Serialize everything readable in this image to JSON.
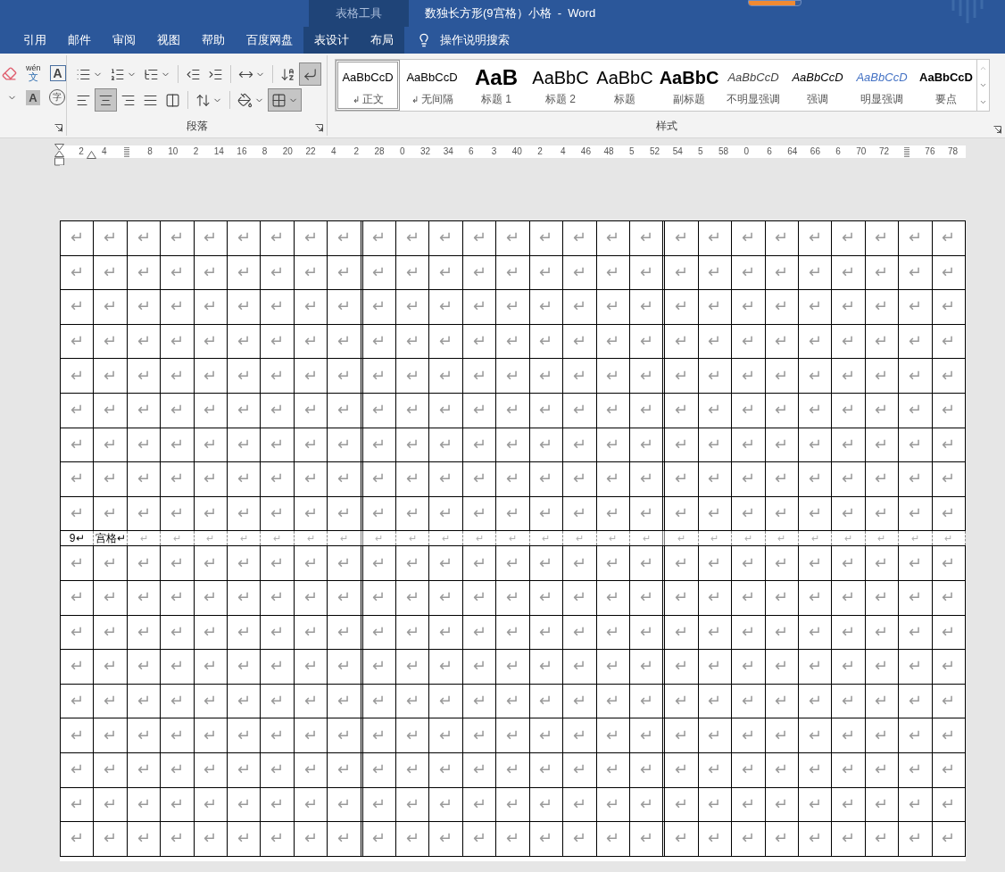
{
  "title_bar": {
    "context_label": "表格工具",
    "title": "数独长方形(9宫格）小格  -  Word",
    "progress": {
      "level": 0.9
    }
  },
  "tabs": [
    {
      "label": "引用",
      "contextual": false
    },
    {
      "label": "邮件",
      "contextual": false
    },
    {
      "label": "审阅",
      "contextual": false
    },
    {
      "label": "视图",
      "contextual": false
    },
    {
      "label": "帮助",
      "contextual": false
    },
    {
      "label": "百度网盘",
      "contextual": false
    },
    {
      "label": "表设计",
      "contextual": true
    },
    {
      "label": "布局",
      "contextual": true
    }
  ],
  "tell_me": {
    "label": "操作说明搜索"
  },
  "font_group": {
    "phonetic_top": "wén",
    "phonetic_char": "文",
    "border_char": "A",
    "shading_char": "A",
    "enclose_char": "字"
  },
  "paragraph_group": {
    "label": "段落",
    "rows": [
      [
        {
          "kind": "bullets",
          "dropdown": true,
          "pressed": false
        },
        {
          "kind": "numbering",
          "dropdown": true,
          "pressed": false
        },
        {
          "kind": "multilevel",
          "dropdown": true,
          "pressed": false
        },
        {
          "kind": "sep"
        },
        {
          "kind": "outdent",
          "dropdown": false,
          "pressed": false
        },
        {
          "kind": "indent",
          "dropdown": false,
          "pressed": false
        },
        {
          "kind": "sep"
        },
        {
          "kind": "layout",
          "dropdown": true,
          "pressed": false
        },
        {
          "kind": "sep"
        },
        {
          "kind": "sort",
          "dropdown": false,
          "pressed": false
        },
        {
          "kind": "marks",
          "dropdown": false,
          "pressed": true
        }
      ],
      [
        {
          "kind": "left",
          "dropdown": false,
          "pressed": false
        },
        {
          "kind": "center",
          "dropdown": false,
          "pressed": true
        },
        {
          "kind": "right",
          "dropdown": false,
          "pressed": false
        },
        {
          "kind": "justify",
          "dropdown": false,
          "pressed": false
        },
        {
          "kind": "distribute",
          "dropdown": false,
          "pressed": false
        },
        {
          "kind": "sep"
        },
        {
          "kind": "spacing",
          "dropdown": true,
          "pressed": false
        },
        {
          "kind": "sep"
        },
        {
          "kind": "shading",
          "dropdown": true,
          "pressed": false
        },
        {
          "kind": "borders",
          "dropdown": true,
          "pressed": true
        }
      ]
    ]
  },
  "styles_group": {
    "label": "样式",
    "items": [
      {
        "kind": "normal",
        "preview": "AaBbCcD",
        "mark": "↲",
        "name": "正文",
        "selected": true
      },
      {
        "kind": "normal",
        "preview": "AaBbCcD",
        "mark": "↲",
        "name": "无间隔",
        "selected": false
      },
      {
        "kind": "heading1",
        "preview": "AaB",
        "name": "标题 1",
        "selected": false
      },
      {
        "kind": "heading2",
        "preview": "AaBbC",
        "name": "标题 2",
        "selected": false
      },
      {
        "kind": "title",
        "preview": "AaBbC",
        "name": "标题",
        "selected": false
      },
      {
        "kind": "subtitle",
        "preview": "AaBbC",
        "name": "副标题",
        "selected": false
      },
      {
        "kind": "subtle",
        "preview": "AaBbCcD",
        "name": "不明显强调",
        "selected": false
      },
      {
        "kind": "emphasis",
        "preview": "AaBbCcD",
        "name": "强调",
        "selected": false
      },
      {
        "kind": "intense",
        "preview": "AaBbCcD",
        "name": "明显强调",
        "selected": false
      },
      {
        "kind": "strong",
        "preview": "AaBbCcD",
        "name": "要点",
        "selected": false
      }
    ]
  },
  "ruler": {
    "ticks": [
      {
        "label": "2"
      },
      {
        "label": "4"
      },
      {
        "kind": "covered"
      },
      {
        "label": "8"
      },
      {
        "label": "10"
      },
      {
        "label": "2"
      },
      {
        "label": "14"
      },
      {
        "label": "16"
      },
      {
        "label": "8"
      },
      {
        "label": "20"
      },
      {
        "label": "22"
      },
      {
        "label": "4"
      },
      {
        "label": "2"
      },
      {
        "label": "28"
      },
      {
        "label": "0"
      },
      {
        "label": "32"
      },
      {
        "label": "34"
      },
      {
        "label": "6"
      },
      {
        "label": "3"
      },
      {
        "label": "40"
      },
      {
        "label": "2"
      },
      {
        "label": "4"
      },
      {
        "label": "46"
      },
      {
        "label": "48"
      },
      {
        "label": "5"
      },
      {
        "label": "52"
      },
      {
        "label": "54"
      },
      {
        "label": "5"
      },
      {
        "label": "58"
      },
      {
        "label": "0"
      },
      {
        "label": "6"
      },
      {
        "label": "64"
      },
      {
        "label": "66"
      },
      {
        "label": "6"
      },
      {
        "label": "70"
      },
      {
        "label": "72"
      },
      {
        "kind": "covered"
      },
      {
        "label": "76"
      },
      {
        "label": "78"
      }
    ]
  },
  "table": {
    "rows": [
      {
        "kind": "grid",
        "cells": [
          "↵",
          "↵",
          "↵",
          "↵",
          "↵",
          "↵",
          "↵",
          "↵",
          "↵",
          "↵",
          "↵",
          "↵",
          "↵",
          "↵",
          "↵",
          "↵",
          "↵",
          "↵",
          "↵",
          "↵",
          "↵",
          "↵",
          "↵",
          "↵",
          "↵",
          "↵",
          "↵"
        ]
      },
      {
        "kind": "grid",
        "cells": [
          "↵",
          "↵",
          "↵",
          "↵",
          "↵",
          "↵",
          "↵",
          "↵",
          "↵",
          "↵",
          "↵",
          "↵",
          "↵",
          "↵",
          "↵",
          "↵",
          "↵",
          "↵",
          "↵",
          "↵",
          "↵",
          "↵",
          "↵",
          "↵",
          "↵",
          "↵",
          "↵"
        ]
      },
      {
        "kind": "grid",
        "cells": [
          "↵",
          "↵",
          "↵",
          "↵",
          "↵",
          "↵",
          "↵",
          "↵",
          "↵",
          "↵",
          "↵",
          "↵",
          "↵",
          "↵",
          "↵",
          "↵",
          "↵",
          "↵",
          "↵",
          "↵",
          "↵",
          "↵",
          "↵",
          "↵",
          "↵",
          "↵",
          "↵"
        ]
      },
      {
        "kind": "grid",
        "cells": [
          "↵",
          "↵",
          "↵",
          "↵",
          "↵",
          "↵",
          "↵",
          "↵",
          "↵",
          "↵",
          "↵",
          "↵",
          "↵",
          "↵",
          "↵",
          "↵",
          "↵",
          "↵",
          "↵",
          "↵",
          "↵",
          "↵",
          "↵",
          "↵",
          "↵",
          "↵",
          "↵"
        ]
      },
      {
        "kind": "grid",
        "cells": [
          "↵",
          "↵",
          "↵",
          "↵",
          "↵",
          "↵",
          "↵",
          "↵",
          "↵",
          "↵",
          "↵",
          "↵",
          "↵",
          "↵",
          "↵",
          "↵",
          "↵",
          "↵",
          "↵",
          "↵",
          "↵",
          "↵",
          "↵",
          "↵",
          "↵",
          "↵",
          "↵"
        ]
      },
      {
        "kind": "grid",
        "cells": [
          "↵",
          "↵",
          "↵",
          "↵",
          "↵",
          "↵",
          "↵",
          "↵",
          "↵",
          "↵",
          "↵",
          "↵",
          "↵",
          "↵",
          "↵",
          "↵",
          "↵",
          "↵",
          "↵",
          "↵",
          "↵",
          "↵",
          "↵",
          "↵",
          "↵",
          "↵",
          "↵"
        ]
      },
      {
        "kind": "grid",
        "cells": [
          "↵",
          "↵",
          "↵",
          "↵",
          "↵",
          "↵",
          "↵",
          "↵",
          "↵",
          "↵",
          "↵",
          "↵",
          "↵",
          "↵",
          "↵",
          "↵",
          "↵",
          "↵",
          "↵",
          "↵",
          "↵",
          "↵",
          "↵",
          "↵",
          "↵",
          "↵",
          "↵"
        ]
      },
      {
        "kind": "grid",
        "cells": [
          "↵",
          "↵",
          "↵",
          "↵",
          "↵",
          "↵",
          "↵",
          "↵",
          "↵",
          "↵",
          "↵",
          "↵",
          "↵",
          "↵",
          "↵",
          "↵",
          "↵",
          "↵",
          "↵",
          "↵",
          "↵",
          "↵",
          "↵",
          "↵",
          "↵",
          "↵",
          "↵"
        ]
      },
      {
        "kind": "grid",
        "cells": [
          "↵",
          "↵",
          "↵",
          "↵",
          "↵",
          "↵",
          "↵",
          "↵",
          "↵",
          "↵",
          "↵",
          "↵",
          "↵",
          "↵",
          "↵",
          "↵",
          "↵",
          "↵",
          "↵",
          "↵",
          "↵",
          "↵",
          "↵",
          "↵",
          "↵",
          "↵",
          "↵"
        ]
      },
      {
        "kind": "caption",
        "cells": [
          {
            "text": "9↵",
            "kind": "label"
          },
          {
            "text": "宫格↵",
            "kind": "label"
          },
          {
            "text": "↵",
            "kind": "mark"
          },
          {
            "text": "↵",
            "kind": "mark"
          },
          {
            "text": "↵",
            "kind": "mark"
          },
          {
            "text": "↵",
            "kind": "mark"
          },
          {
            "text": "↵",
            "kind": "mark"
          },
          {
            "text": "↵",
            "kind": "mark"
          },
          {
            "text": "↵",
            "kind": "mark"
          },
          {
            "text": "↵",
            "kind": "mark"
          },
          {
            "text": "↵",
            "kind": "mark"
          },
          {
            "text": "↵",
            "kind": "mark"
          },
          {
            "text": "↵",
            "kind": "mark"
          },
          {
            "text": "↵",
            "kind": "mark"
          },
          {
            "text": "↵",
            "kind": "mark"
          },
          {
            "text": "↵",
            "kind": "mark"
          },
          {
            "text": "↵",
            "kind": "mark"
          },
          {
            "text": "↵",
            "kind": "mark"
          },
          {
            "text": "↵",
            "kind": "mark"
          },
          {
            "text": "↵",
            "kind": "mark"
          },
          {
            "text": "↵",
            "kind": "mark"
          },
          {
            "text": "↵",
            "kind": "mark"
          },
          {
            "text": "↵",
            "kind": "mark"
          },
          {
            "text": "↵",
            "kind": "mark"
          },
          {
            "text": "↵",
            "kind": "mark"
          },
          {
            "text": "↵",
            "kind": "mark"
          },
          {
            "text": "↵",
            "kind": "mark"
          }
        ]
      },
      {
        "kind": "grid",
        "cells": [
          "↵",
          "↵",
          "↵",
          "↵",
          "↵",
          "↵",
          "↵",
          "↵",
          "↵",
          "↵",
          "↵",
          "↵",
          "↵",
          "↵",
          "↵",
          "↵",
          "↵",
          "↵",
          "↵",
          "↵",
          "↵",
          "↵",
          "↵",
          "↵",
          "↵",
          "↵",
          "↵"
        ]
      },
      {
        "kind": "grid",
        "cells": [
          "↵",
          "↵",
          "↵",
          "↵",
          "↵",
          "↵",
          "↵",
          "↵",
          "↵",
          "↵",
          "↵",
          "↵",
          "↵",
          "↵",
          "↵",
          "↵",
          "↵",
          "↵",
          "↵",
          "↵",
          "↵",
          "↵",
          "↵",
          "↵",
          "↵",
          "↵",
          "↵"
        ]
      },
      {
        "kind": "grid",
        "cells": [
          "↵",
          "↵",
          "↵",
          "↵",
          "↵",
          "↵",
          "↵",
          "↵",
          "↵",
          "↵",
          "↵",
          "↵",
          "↵",
          "↵",
          "↵",
          "↵",
          "↵",
          "↵",
          "↵",
          "↵",
          "↵",
          "↵",
          "↵",
          "↵",
          "↵",
          "↵",
          "↵"
        ]
      },
      {
        "kind": "grid",
        "cells": [
          "↵",
          "↵",
          "↵",
          "↵",
          "↵",
          "↵",
          "↵",
          "↵",
          "↵",
          "↵",
          "↵",
          "↵",
          "↵",
          "↵",
          "↵",
          "↵",
          "↵",
          "↵",
          "↵",
          "↵",
          "↵",
          "↵",
          "↵",
          "↵",
          "↵",
          "↵",
          "↵"
        ]
      },
      {
        "kind": "grid",
        "cells": [
          "↵",
          "↵",
          "↵",
          "↵",
          "↵",
          "↵",
          "↵",
          "↵",
          "↵",
          "↵",
          "↵",
          "↵",
          "↵",
          "↵",
          "↵",
          "↵",
          "↵",
          "↵",
          "↵",
          "↵",
          "↵",
          "↵",
          "↵",
          "↵",
          "↵",
          "↵",
          "↵"
        ]
      },
      {
        "kind": "grid",
        "cells": [
          "↵",
          "↵",
          "↵",
          "↵",
          "↵",
          "↵",
          "↵",
          "↵",
          "↵",
          "↵",
          "↵",
          "↵",
          "↵",
          "↵",
          "↵",
          "↵",
          "↵",
          "↵",
          "↵",
          "↵",
          "↵",
          "↵",
          "↵",
          "↵",
          "↵",
          "↵",
          "↵"
        ]
      },
      {
        "kind": "grid",
        "cells": [
          "↵",
          "↵",
          "↵",
          "↵",
          "↵",
          "↵",
          "↵",
          "↵",
          "↵",
          "↵",
          "↵",
          "↵",
          "↵",
          "↵",
          "↵",
          "↵",
          "↵",
          "↵",
          "↵",
          "↵",
          "↵",
          "↵",
          "↵",
          "↵",
          "↵",
          "↵",
          "↵"
        ]
      },
      {
        "kind": "grid",
        "cells": [
          "↵",
          "↵",
          "↵",
          "↵",
          "↵",
          "↵",
          "↵",
          "↵",
          "↵",
          "↵",
          "↵",
          "↵",
          "↵",
          "↵",
          "↵",
          "↵",
          "↵",
          "↵",
          "↵",
          "↵",
          "↵",
          "↵",
          "↵",
          "↵",
          "↵",
          "↵",
          "↵"
        ]
      },
      {
        "kind": "grid",
        "cells": [
          "↵",
          "↵",
          "↵",
          "↵",
          "↵",
          "↵",
          "↵",
          "↵",
          "↵",
          "↵",
          "↵",
          "↵",
          "↵",
          "↵",
          "↵",
          "↵",
          "↵",
          "↵",
          "↵",
          "↵",
          "↵",
          "↵",
          "↵",
          "↵",
          "↵",
          "↵",
          "↵"
        ]
      }
    ]
  }
}
